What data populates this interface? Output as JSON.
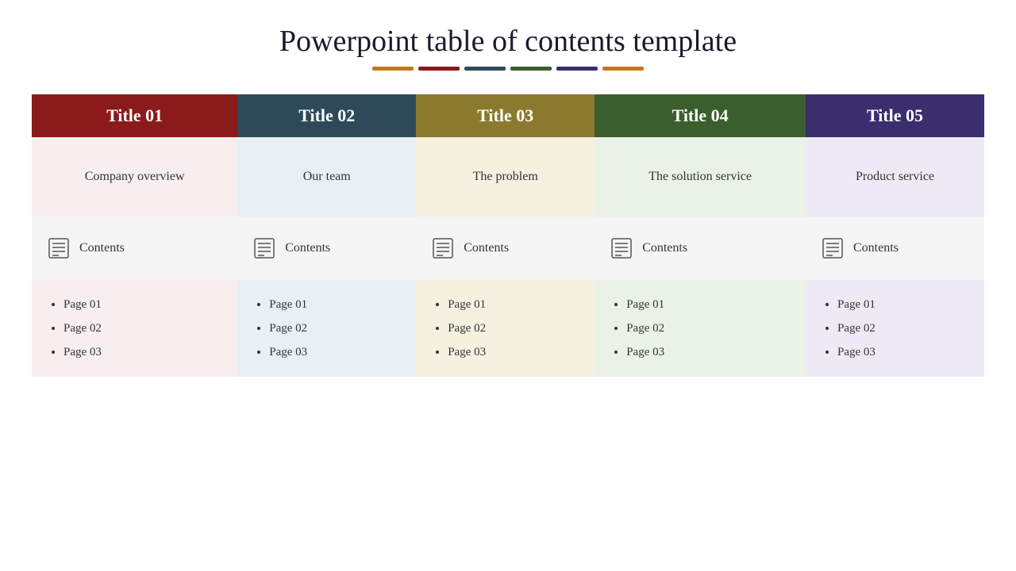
{
  "header": {
    "title": "Powerpoint table of contents template"
  },
  "color_bars": [
    {
      "color": "#c07820"
    },
    {
      "color": "#8b1a1a"
    },
    {
      "color": "#2e4a5a"
    },
    {
      "color": "#3a5e2e"
    },
    {
      "color": "#3a2e6e"
    },
    {
      "color": "#c07820"
    }
  ],
  "columns": [
    {
      "id": 1,
      "header": "Title 01",
      "subtitle": "Company overview",
      "contents_label": "Contents",
      "pages": [
        "Page 01",
        "Page 02",
        "Page 03"
      ]
    },
    {
      "id": 2,
      "header": "Title 02",
      "subtitle": "Our team",
      "contents_label": "Contents",
      "pages": [
        "Page 01",
        "Page 02",
        "Page 03"
      ]
    },
    {
      "id": 3,
      "header": "Title 03",
      "subtitle": "The problem",
      "contents_label": "Contents",
      "pages": [
        "Page 01",
        "Page 02",
        "Page 03"
      ]
    },
    {
      "id": 4,
      "header": "Title 04",
      "subtitle": "The solution service",
      "contents_label": "Contents",
      "pages": [
        "Page 01",
        "Page 02",
        "Page 03"
      ]
    },
    {
      "id": 5,
      "header": "Title 05",
      "subtitle": "Product service",
      "contents_label": "Contents",
      "pages": [
        "Page 01",
        "Page 02",
        "Page 03"
      ]
    }
  ]
}
